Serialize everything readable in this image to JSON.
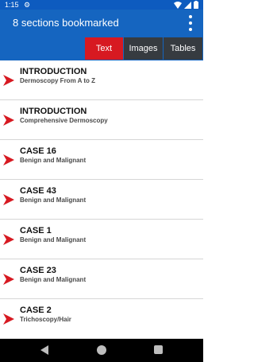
{
  "status_bar": {
    "time": "1:15",
    "settings_icon": "gear-icon",
    "wifi_icon": "wifi-icon",
    "signal_icon": "cell-signal-icon",
    "battery_icon": "battery-icon"
  },
  "app_bar": {
    "title": "8 sections bookmarked",
    "overflow_icon": "more-vert-icon"
  },
  "tabs": [
    {
      "label": "Text",
      "active": true
    },
    {
      "label": "Images",
      "active": false
    },
    {
      "label": "Tables",
      "active": false
    }
  ],
  "items": [
    {
      "title": "INTRODUCTION",
      "subtitle": "Dermoscopy From A to Z"
    },
    {
      "title": "INTRODUCTION",
      "subtitle": "Comprehensive Dermoscopy"
    },
    {
      "title": "CASE 16",
      "subtitle": "Benign and Malignant"
    },
    {
      "title": "CASE 43",
      "subtitle": "Benign and Malignant"
    },
    {
      "title": "CASE 1",
      "subtitle": "Benign and Malignant"
    },
    {
      "title": "CASE 23",
      "subtitle": "Benign and Malignant"
    },
    {
      "title": "CASE 2",
      "subtitle": "Trichoscopy/Hair"
    }
  ],
  "colors": {
    "primary": "#1565c0",
    "accent": "#d71921",
    "tab_inactive": "#363b40",
    "arrow": "#d71921"
  },
  "nav_bar": {
    "back_icon": "back-triangle-icon",
    "home_icon": "home-circle-icon",
    "recents_icon": "recents-square-icon"
  }
}
